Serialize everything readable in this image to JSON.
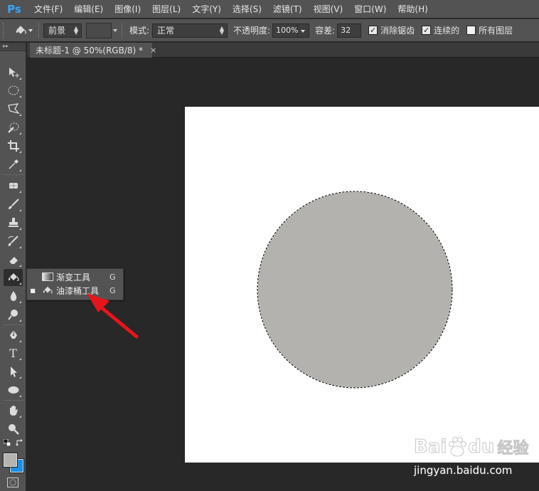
{
  "app": {
    "logo": "Ps"
  },
  "menu": [
    "文件(F)",
    "编辑(E)",
    "图像(I)",
    "图层(L)",
    "文字(Y)",
    "选择(S)",
    "滤镜(T)",
    "视图(V)",
    "窗口(W)",
    "帮助(H)"
  ],
  "options": {
    "fill_source": "前景",
    "mode_label": "模式:",
    "mode_value": "正常",
    "opacity_label": "不透明度:",
    "opacity_value": "100%",
    "tolerance_label": "容差:",
    "tolerance_value": "32",
    "antialias_label": "消除锯齿",
    "antialias_checked": true,
    "contiguous_label": "连续的",
    "contiguous_checked": true,
    "all_layers_label": "所有图层",
    "all_layers_checked": false
  },
  "document": {
    "tab_title": "未标题-1 @ 50%(RGB/8) *",
    "close": "×"
  },
  "toolbar": {
    "tools": [
      "move-icon",
      "elliptical-marquee-icon",
      "polygonal-lasso-icon",
      "quick-selection-icon",
      "crop-icon",
      "eyedropper-icon",
      "healing-brush-icon",
      "brush-icon",
      "clone-stamp-icon",
      "history-brush-icon",
      "eraser-icon",
      "paint-bucket-icon",
      "blur-icon",
      "dodge-icon",
      "pen-icon",
      "type-icon",
      "path-selection-icon",
      "ellipse-icon",
      "hand-icon",
      "zoom-icon"
    ],
    "type_tool_glyph": "T",
    "foreground_color": "#b5b4b0",
    "background_color": "#1e8fe0"
  },
  "flyout": {
    "items": [
      {
        "label": "渐变工具",
        "shortcut": "G",
        "selected": false,
        "icon": "gradient-icon"
      },
      {
        "label": "油漆桶工具",
        "shortcut": "G",
        "selected": true,
        "icon": "paint-bucket-icon"
      }
    ],
    "selected_marker": "■"
  },
  "canvas": {
    "background": "#ffffff",
    "circle_fill": "#b3b2ae",
    "selection": "marching-ants"
  },
  "annotation": {
    "arrow_color": "#e8141c"
  },
  "watermark": {
    "logo_text": "Bai",
    "logo_text2": "du",
    "logo_cn": "经验",
    "url": "jingyan.baidu.com"
  }
}
